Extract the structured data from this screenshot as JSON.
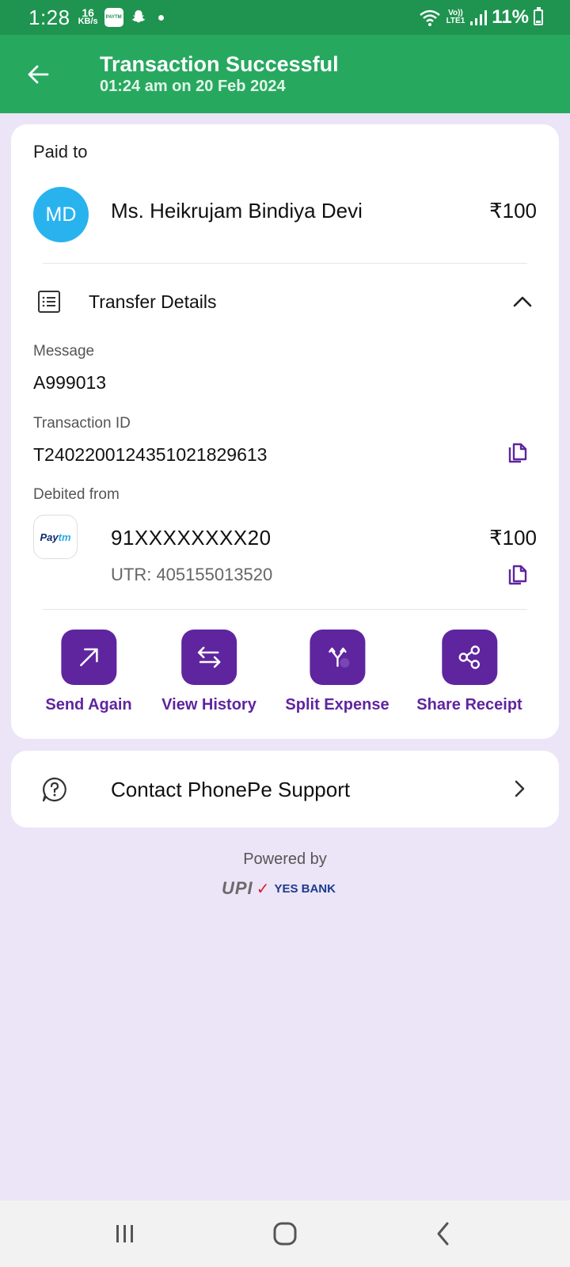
{
  "status_bar": {
    "time": "1:28",
    "speed_value": "16",
    "speed_unit": "KB/s",
    "app_icon_label": "PAYTM",
    "network_label_top": "Vo))",
    "network_label_bottom": "LTE1",
    "battery": "11%",
    "icons": [
      "paytm-icon",
      "snapchat-icon",
      "dot-icon",
      "wifi-icon",
      "signal-icon",
      "battery-charging-icon"
    ]
  },
  "header": {
    "title": "Transaction Successful",
    "subtitle": "01:24 am on 20 Feb 2024",
    "background": "#27a85f"
  },
  "paid_to": {
    "label": "Paid to",
    "avatar_initials": "MD",
    "avatar_color": "#29b3ee",
    "name": "Ms. Heikrujam Bindiya Devi",
    "amount": "₹100"
  },
  "transfer_details": {
    "title": "Transfer Details",
    "message_label": "Message",
    "message_value": "A999013",
    "transaction_id_label": "Transaction ID",
    "transaction_id_value": "T2402200124351021829613",
    "debited_from_label": "Debited from",
    "bank_logo_pay": "Pay",
    "bank_logo_tm": "tm",
    "account_number": "91XXXXXXXX20",
    "debit_amount": "₹100",
    "utr": "UTR: 405155013520"
  },
  "actions": [
    {
      "label": "Send Again",
      "icon": "arrow-up-right-icon"
    },
    {
      "label": "View History",
      "icon": "swap-arrows-icon"
    },
    {
      "label": "Split Expense",
      "icon": "split-icon"
    },
    {
      "label": "Share Receipt",
      "icon": "share-icon"
    }
  ],
  "accent_color": "#5f259f",
  "support": {
    "label": "Contact PhonePe Support"
  },
  "footer": {
    "powered_by": "Powered by",
    "upi_text": "UPI",
    "bank_text": "YES BANK"
  }
}
